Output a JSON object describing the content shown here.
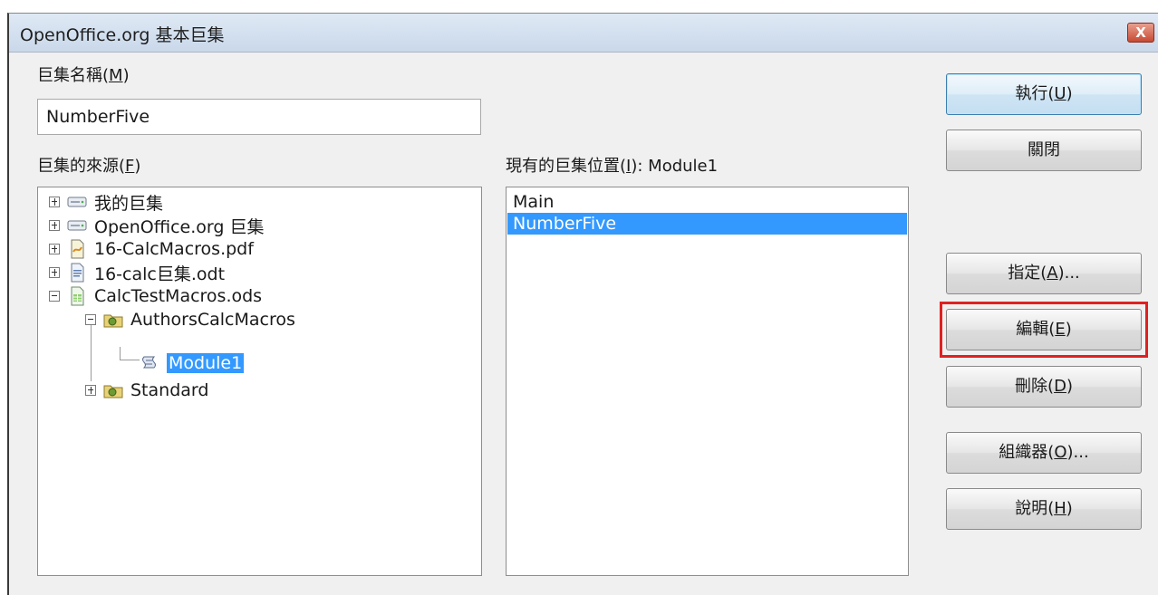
{
  "window": {
    "title": "OpenOffice.org 基本巨集",
    "close_label": "X"
  },
  "macro_name": {
    "label": "巨集名稱",
    "mnemonic": "M",
    "value": "NumberFive"
  },
  "macro_from": {
    "label": "巨集的來源",
    "mnemonic": "F"
  },
  "existing_in": {
    "label": "現有的巨集位置",
    "mnemonic": "I",
    "module": ": Module1"
  },
  "tree": {
    "items": [
      {
        "label": "我的巨集",
        "expander": "plus",
        "icon": "drive-icon"
      },
      {
        "label": "OpenOffice.org 巨集",
        "expander": "plus",
        "icon": "drive-icon"
      },
      {
        "label": "16-CalcMacros.pdf",
        "expander": "plus",
        "icon": "document-icon"
      },
      {
        "label": "16-calc巨集.odt",
        "expander": "plus",
        "icon": "writer-document-icon"
      },
      {
        "label": "CalcTestMacros.ods",
        "expander": "minus",
        "icon": "spreadsheet-icon"
      },
      {
        "label": "AuthorsCalcMacros",
        "expander": "minus",
        "icon": "library-icon"
      },
      {
        "label": "Module1",
        "expander": "none",
        "icon": "module-icon",
        "selected": true
      },
      {
        "label": "Standard",
        "expander": "plus",
        "icon": "library-icon"
      }
    ]
  },
  "macro_list": {
    "items": [
      {
        "label": "Main"
      },
      {
        "label": "NumberFive",
        "selected": true
      }
    ]
  },
  "buttons": {
    "run": {
      "label": "執行",
      "mnemonic": "U"
    },
    "close": {
      "label": "關閉"
    },
    "assign": {
      "label": "指定",
      "mnemonic": "A",
      "suffix": "..."
    },
    "edit": {
      "label": "編輯",
      "mnemonic": "E"
    },
    "delete": {
      "label": "刪除",
      "mnemonic": "D"
    },
    "organizer": {
      "label": "組織器",
      "mnemonic": "O",
      "suffix": "..."
    },
    "help": {
      "label": "說明",
      "mnemonic": "H"
    }
  },
  "colors": {
    "selection": "#3399ff",
    "highlight_box": "#e02020",
    "titlebar": "#c9d8ea"
  }
}
